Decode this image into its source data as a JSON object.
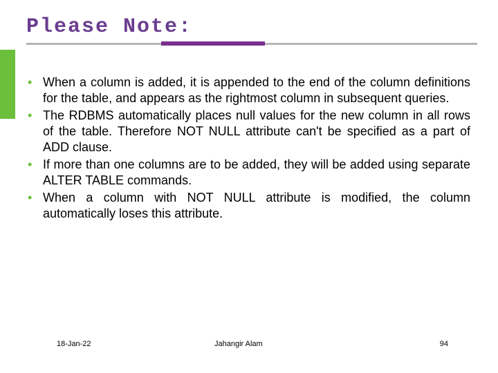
{
  "title": "Please Note:",
  "bullets": [
    "When a column is added, it is appended to the end of the column definitions for the table, and appears as the rightmost column in subsequent queries.",
    "The RDBMS automatically places null values for the new column in all rows of the table. Therefore NOT NULL attribute can't be specified as a part of ADD clause.",
    "If more than one columns are to be added, they will be added using separate ALTER TABLE commands.",
    "When a column with NOT NULL attribute is modified, the column automatically loses this attribute."
  ],
  "footer": {
    "date": "18-Jan-22",
    "author": "Jahangir Alam",
    "page": "94"
  }
}
